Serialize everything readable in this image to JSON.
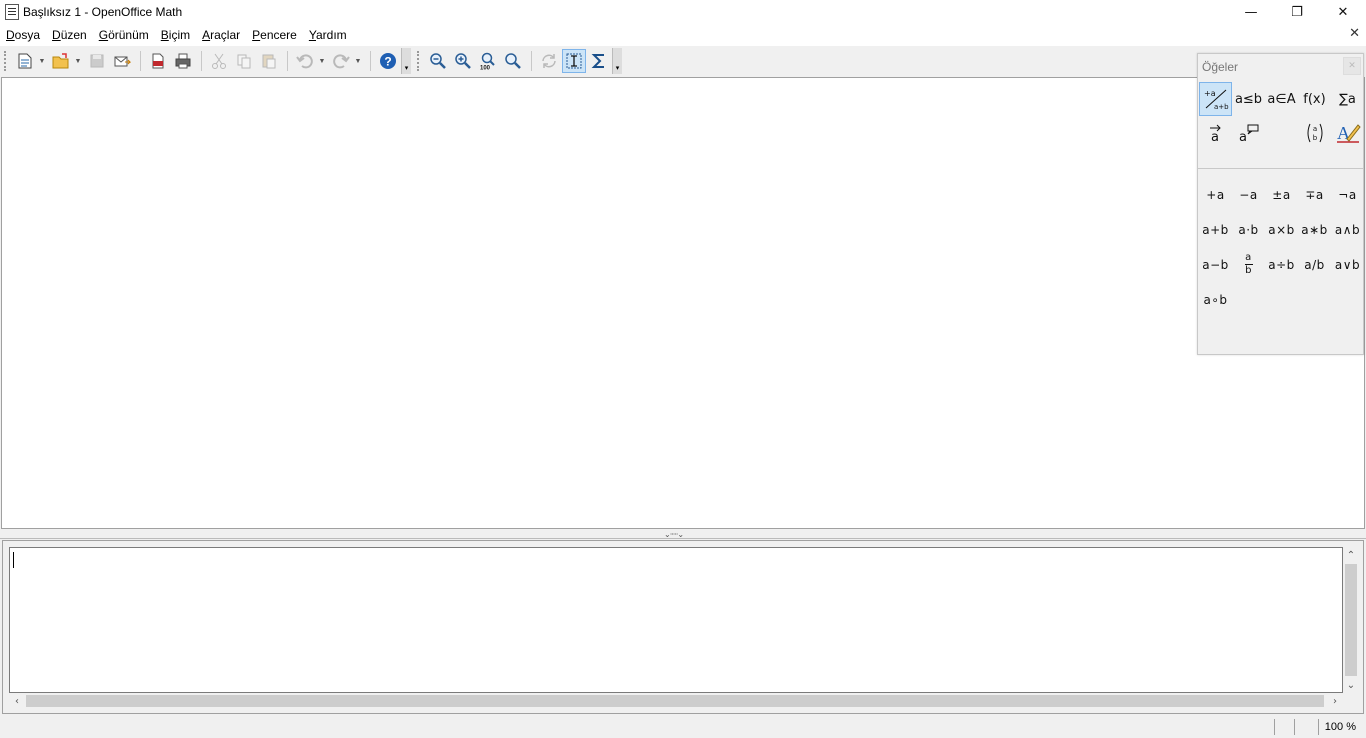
{
  "window": {
    "title": "Başlıksız 1 - OpenOffice Math",
    "controls": {
      "minimize": "—",
      "maximize": "❐",
      "close": "✕"
    }
  },
  "menu": [
    {
      "pre": "",
      "ul": "D",
      "post": "osya"
    },
    {
      "pre": "",
      "ul": "D",
      "post": "üzen"
    },
    {
      "pre": "",
      "ul": "G",
      "post": "örünüm"
    },
    {
      "pre": "",
      "ul": "B",
      "post": "içim"
    },
    {
      "pre": "",
      "ul": "A",
      "post": "raçlar"
    },
    {
      "pre": "",
      "ul": "P",
      "post": "encere"
    },
    {
      "pre": "",
      "ul": "Y",
      "post": "ardım"
    }
  ],
  "doc_close": "✕",
  "toolbar": {
    "buttons": [
      "new-icon",
      "open-icon",
      "save-icon",
      "email-icon",
      "export-pdf-icon",
      "print-icon",
      "cut-icon",
      "copy-icon",
      "paste-icon",
      "undo-icon",
      "redo-icon",
      "help-icon",
      "zoom-out-icon",
      "zoom-in-icon",
      "zoom-100-icon",
      "show-all-icon",
      "update-icon",
      "formula-cursor-icon",
      "symbols-icon"
    ],
    "zoom_100_label": "100",
    "more": "▾"
  },
  "splitter_grip": "⌄·····⌄",
  "command": {
    "text": "",
    "scroll_up": "⌃",
    "scroll_down": "⌄",
    "scroll_left": "‹",
    "scroll_right": "›"
  },
  "status": {
    "zoom": "100 %"
  },
  "elements_panel": {
    "title": "Öğeler",
    "close": "✕",
    "categories": [
      {
        "name": "unary-binary-operators",
        "label": ""
      },
      {
        "name": "relations",
        "label": "a≤b"
      },
      {
        "name": "set-operations",
        "label": "a∈A"
      },
      {
        "name": "functions",
        "label": "f(x)"
      },
      {
        "name": "operators",
        "label": "∑a"
      },
      {
        "name": "attributes",
        "label": "a⃗"
      },
      {
        "name": "others",
        "label": "a💬"
      },
      {
        "name": "brackets-empty",
        "label": ""
      },
      {
        "name": "brackets",
        "label": "(a b)"
      },
      {
        "name": "formats",
        "label": "A✎"
      }
    ],
    "operators": [
      "+a",
      "−a",
      "±a",
      "∓a",
      "¬a",
      "a+b",
      "a·b",
      "a×b",
      "a∗b",
      "a∧b",
      "a−b",
      "",
      "a÷b",
      "a/b",
      "a∨b",
      "a∘b"
    ],
    "fraction": {
      "num": "a",
      "den": "b"
    }
  },
  "colors": {
    "accent": "#cce4f7",
    "accent_border": "#7eb4ea",
    "help_blue": "#1f5fb3",
    "pdf_red": "#c0282d"
  }
}
